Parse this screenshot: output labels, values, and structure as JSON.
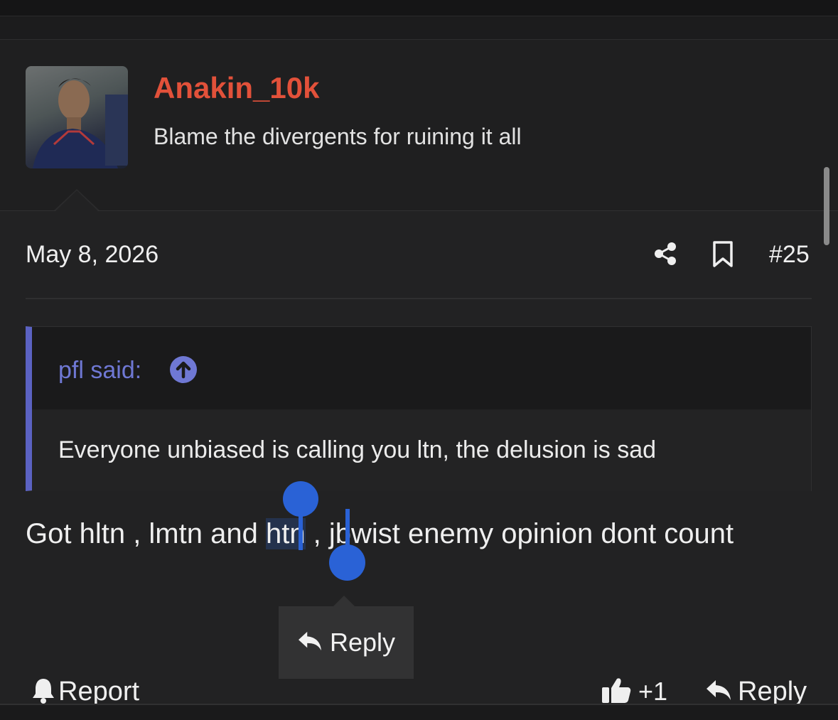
{
  "post": {
    "username": "Anakin_10k",
    "user_title": "Blame the divergents for ruining it all",
    "date": "May 8, 2026",
    "post_number": "#25",
    "quote": {
      "author": "pfl said:",
      "text": "Everyone unbiased is calling you ltn, the delusion is sad"
    },
    "message": {
      "before": "Got hltn , lmtn and ",
      "selected": "htn",
      "after": " , jbwist enemy opinion dont count"
    }
  },
  "selection_popup": {
    "reply_label": "Reply"
  },
  "footer": {
    "report_label": "Report",
    "like_count": "+1",
    "reply_label": "Reply"
  },
  "colors": {
    "username": "#e2513a",
    "quote_accent": "#5b62c2",
    "selection_handle": "#2a62d6"
  }
}
